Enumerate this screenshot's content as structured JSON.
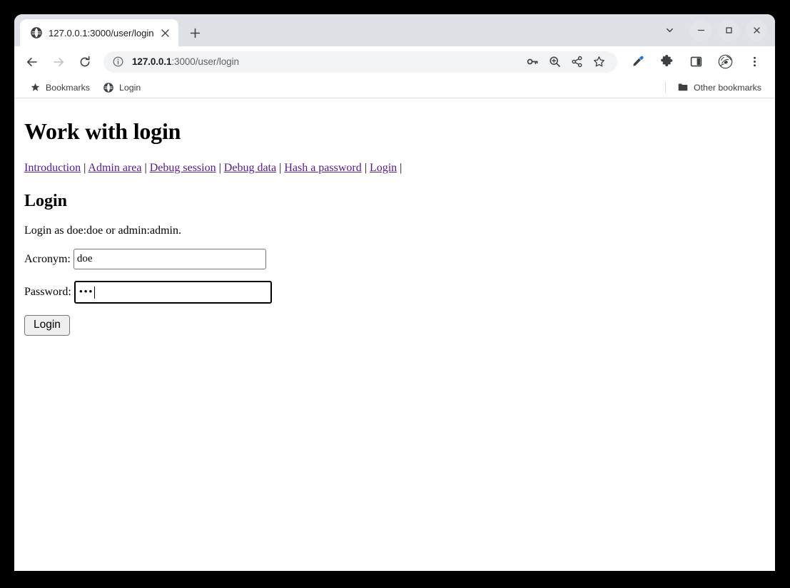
{
  "browser": {
    "tab": {
      "title": "127.0.0.1:3000/user/login",
      "favicon_icon": "globe-icon",
      "close_icon": "close-icon"
    },
    "new_tab_label": "+",
    "window_controls": {
      "tab_search_icon": "chevron-down-icon",
      "minimize_icon": "minimize-icon",
      "maximize_icon": "maximize-icon",
      "close_icon": "close-icon"
    },
    "nav": {
      "back_icon": "back-arrow-icon",
      "forward_icon": "forward-arrow-icon",
      "reload_icon": "reload-icon"
    },
    "omnibox": {
      "info_icon": "info-circle-icon",
      "url_host": "127.0.0.1",
      "url_path": ":3000/user/login",
      "full_url": "127.0.0.1:3000/user/login",
      "actions": [
        {
          "icon": "key-icon",
          "label": "Password manager"
        },
        {
          "icon": "zoom-icon",
          "label": "Zoom"
        },
        {
          "icon": "share-icon",
          "label": "Share this page"
        },
        {
          "icon": "star-icon",
          "label": "Bookmark this tab"
        }
      ]
    },
    "toolbar_right": [
      {
        "icon": "eyedropper-icon",
        "label": "Eyedropper",
        "color": "#1a73e8"
      },
      {
        "icon": "puzzle-piece-icon",
        "label": "Extensions"
      },
      {
        "icon": "side-panel-icon",
        "label": "Side panel"
      },
      {
        "icon": "profile-avatar-icon",
        "label": "Profile"
      },
      {
        "icon": "three-dot-menu-icon",
        "label": "Customize and control"
      }
    ],
    "bookmarks_bar": {
      "items": [
        {
          "label": "Bookmarks",
          "icon": "star-icon"
        },
        {
          "label": "Login",
          "icon": "globe-icon"
        }
      ],
      "other_bookmarks": {
        "label": "Other bookmarks",
        "icon": "folder-icon"
      }
    }
  },
  "page": {
    "h1": "Work with login",
    "nav_links": [
      {
        "label": "Introduction"
      },
      {
        "label": "Admin area"
      },
      {
        "label": "Debug session"
      },
      {
        "label": "Debug data"
      },
      {
        "label": "Hash a password"
      },
      {
        "label": "Login"
      }
    ],
    "nav_separator": "|",
    "h2": "Login",
    "intro": "Login as doe:doe or admin:admin.",
    "form": {
      "acronym_label": "Acronym:",
      "acronym_value": "doe",
      "password_label": "Password:",
      "password_masked": "•••",
      "submit_label": "Login"
    },
    "link_color": "#551a8b"
  }
}
